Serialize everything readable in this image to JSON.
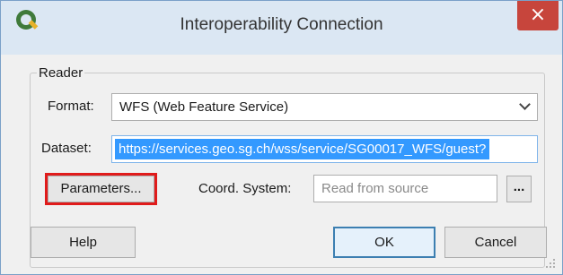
{
  "window": {
    "title": "Interoperability Connection",
    "close_glyph": "×",
    "app_icon": "qgis-logo-icon",
    "accent": "#3399ff",
    "close_color": "#c7453c",
    "highlight_color": "#e01b1b"
  },
  "reader": {
    "group_title": "Reader",
    "format_label": "Format:",
    "format_value": "WFS (Web Feature Service)",
    "dataset_label": "Dataset:",
    "dataset_value": "https://services.geo.sg.ch/wss/service/SG00017_WFS/guest?",
    "parameters_label": "Parameters...",
    "coord_label": "Coord. System:",
    "coord_placeholder": "Read from source",
    "browse_label": "..."
  },
  "footer": {
    "help_label": "Help",
    "ok_label": "OK",
    "cancel_label": "Cancel"
  }
}
